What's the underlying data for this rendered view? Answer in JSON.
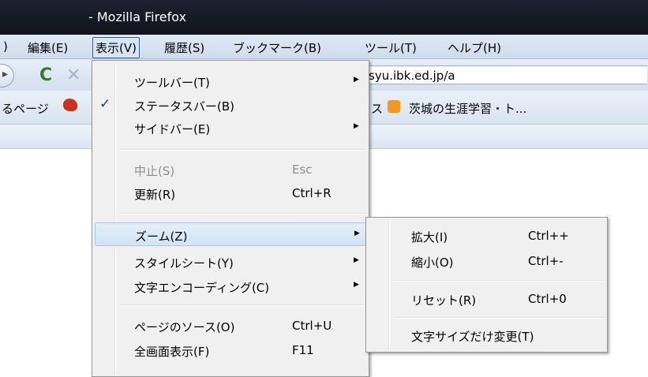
{
  "window": {
    "title": "- Mozilla Firefox"
  },
  "menubar": {
    "items": [
      {
        "label": ")"
      },
      {
        "label": "編集(E)"
      },
      {
        "label": "表示(V)"
      },
      {
        "label": "履歴(S)"
      },
      {
        "label": "ブックマーク(B)"
      },
      {
        "label": "ツール(T)"
      },
      {
        "label": "ヘルプ(H)"
      }
    ]
  },
  "navbar": {
    "url": "syu.ibk.ed.jp/a",
    "icons": [
      "back-icon",
      "reload-icon",
      "stop-icon"
    ]
  },
  "bookmarks": {
    "left_label": "るページ",
    "middle_label": "ス",
    "right_label": "茨城の生涯学習・ト..."
  },
  "view_menu": {
    "items": [
      {
        "label": "ツールバー(T)",
        "shortcut": "",
        "submenu": true,
        "checked": false,
        "disabled": false
      },
      {
        "label": "ステータスバー(B)",
        "shortcut": "",
        "submenu": false,
        "checked": true,
        "disabled": false
      },
      {
        "label": "サイドバー(E)",
        "shortcut": "",
        "submenu": true,
        "checked": false,
        "disabled": false
      },
      {
        "label": "中止(S)",
        "shortcut": "Esc",
        "submenu": false,
        "checked": false,
        "disabled": true
      },
      {
        "label": "更新(R)",
        "shortcut": "Ctrl+R",
        "submenu": false,
        "checked": false,
        "disabled": false
      },
      {
        "label": "ズーム(Z)",
        "shortcut": "",
        "submenu": true,
        "checked": false,
        "disabled": false,
        "highlighted": true
      },
      {
        "label": "スタイルシート(Y)",
        "shortcut": "",
        "submenu": true,
        "checked": false,
        "disabled": false
      },
      {
        "label": "文字エンコーディング(C)",
        "shortcut": "",
        "submenu": true,
        "checked": false,
        "disabled": false
      },
      {
        "label": "ページのソース(O)",
        "shortcut": "Ctrl+U",
        "submenu": false,
        "checked": false,
        "disabled": false
      },
      {
        "label": "全画面表示(F)",
        "shortcut": "F11",
        "submenu": false,
        "checked": false,
        "disabled": false
      }
    ]
  },
  "zoom_submenu": {
    "items": [
      {
        "label": "拡大(I)",
        "shortcut": "Ctrl++"
      },
      {
        "label": "縮小(O)",
        "shortcut": "Ctrl+-"
      },
      {
        "label": "リセット(R)",
        "shortcut": "Ctrl+0"
      },
      {
        "label": "文字サイズだけ変更(T)",
        "shortcut": ""
      }
    ]
  }
}
